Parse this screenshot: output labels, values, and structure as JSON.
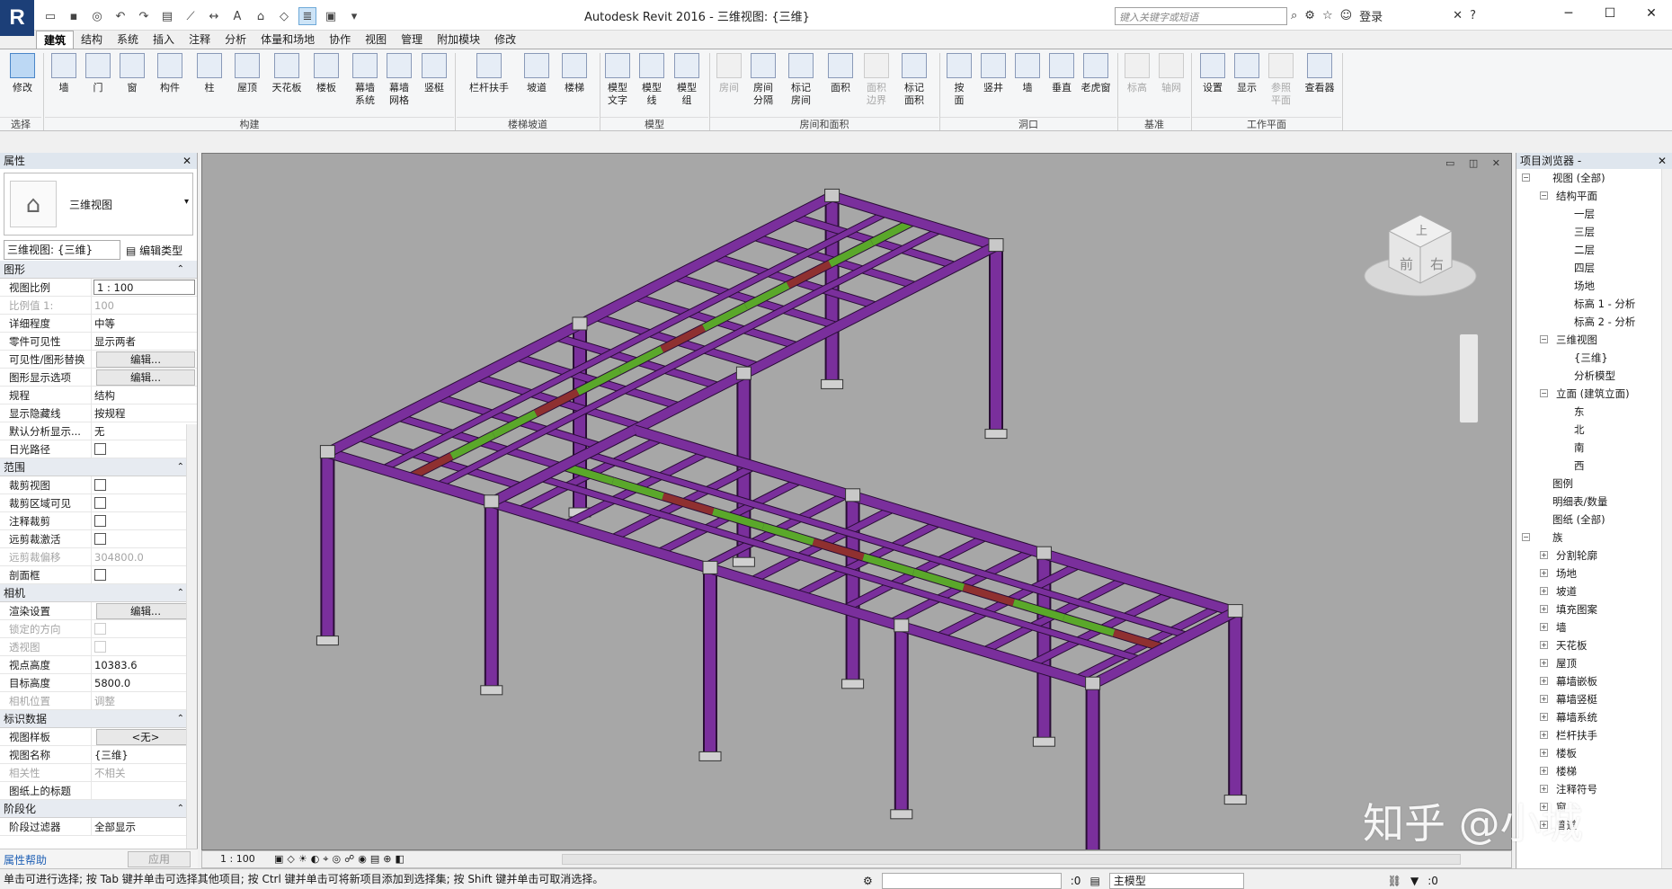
{
  "titlebar": {
    "app": "R",
    "title": "Autodesk Revit 2016 -    三维视图: {三维}",
    "search_placeholder": "键入关键字或短语",
    "login": "登录",
    "help": "?"
  },
  "ribbon_tabs": [
    "建筑",
    "结构",
    "系统",
    "插入",
    "注释",
    "分析",
    "体量和场地",
    "协作",
    "视图",
    "管理",
    "附加模块",
    "修改"
  ],
  "ribbon": {
    "select_label": "选择",
    "modify": "修改",
    "groups": [
      "构建",
      "楼梯坡道",
      "模型",
      "房间和面积",
      "洞口",
      "基准",
      "工作平面"
    ],
    "buttons": {
      "wall": "墙",
      "door": "门",
      "window": "窗",
      "component": "构件",
      "column": "柱",
      "roof": "屋顶",
      "ceiling": "天花板",
      "floor": "楼板",
      "curtain_system_1": "幕墙",
      "curtain_system_2": "系统",
      "curtain_grid_1": "幕墙",
      "curtain_grid_2": "网格",
      "mullion": "竖梃",
      "railing": "栏杆扶手",
      "ramp": "坡道",
      "stair": "楼梯",
      "model_text_1": "模型",
      "model_text_2": "文字",
      "model_line_1": "模型",
      "model_line_2": "线",
      "model_group_1": "模型",
      "model_group_2": "组",
      "room": "房间",
      "room_sep_1": "房间",
      "room_sep_2": "分隔",
      "tag_room_1": "标记",
      "tag_room_2": "房间",
      "area": "面积",
      "area_boundary_1": "面积",
      "area_boundary_2": "边界",
      "tag_area_1": "标记",
      "tag_area_2": "面积",
      "by_face_1": "按",
      "by_face_2": "面",
      "shaft": "竖井",
      "opening_wall": "墙",
      "vertical": "垂直",
      "dormer": "老虎窗",
      "level": "标高",
      "grid": "轴网",
      "set": "设置",
      "show": "显示",
      "ref_plane_1": "参照",
      "ref_plane_2": "平面",
      "viewer": "查看器"
    }
  },
  "properties": {
    "title": "属性",
    "type_name": "三维视图",
    "view_selector": "三维视图: {三维}",
    "edit_type": "编辑类型",
    "sections": [
      {
        "name": "图形",
        "rows": [
          {
            "k": "视图比例",
            "v": "1 : 100",
            "t": "input"
          },
          {
            "k": "比例值 1:",
            "v": "100",
            "t": "dis"
          },
          {
            "k": "详细程度",
            "v": "中等",
            "t": "text"
          },
          {
            "k": "零件可见性",
            "v": "显示两者",
            "t": "text"
          },
          {
            "k": "可见性/图形替换",
            "v": "编辑...",
            "t": "btn"
          },
          {
            "k": "图形显示选项",
            "v": "编辑...",
            "t": "btn"
          },
          {
            "k": "规程",
            "v": "结构",
            "t": "text"
          },
          {
            "k": "显示隐藏线",
            "v": "按规程",
            "t": "text"
          },
          {
            "k": "默认分析显示...",
            "v": "无",
            "t": "text"
          },
          {
            "k": "日光路径",
            "v": "",
            "t": "chk"
          }
        ]
      },
      {
        "name": "范围",
        "rows": [
          {
            "k": "裁剪视图",
            "v": "",
            "t": "chk"
          },
          {
            "k": "裁剪区域可见",
            "v": "",
            "t": "chk"
          },
          {
            "k": "注释裁剪",
            "v": "",
            "t": "chk"
          },
          {
            "k": "远剪裁激活",
            "v": "",
            "t": "chk"
          },
          {
            "k": "远剪裁偏移",
            "v": "304800.0",
            "t": "dis"
          },
          {
            "k": "剖面框",
            "v": "",
            "t": "chk"
          }
        ]
      },
      {
        "name": "相机",
        "rows": [
          {
            "k": "渲染设置",
            "v": "编辑...",
            "t": "btn"
          },
          {
            "k": "锁定的方向",
            "v": "",
            "t": "dischk"
          },
          {
            "k": "透视图",
            "v": "",
            "t": "dischk"
          },
          {
            "k": "视点高度",
            "v": "10383.6",
            "t": "text"
          },
          {
            "k": "目标高度",
            "v": "5800.0",
            "t": "text"
          },
          {
            "k": "相机位置",
            "v": "调整",
            "t": "dis"
          }
        ]
      },
      {
        "name": "标识数据",
        "rows": [
          {
            "k": "视图样板",
            "v": "<无>",
            "t": "btn"
          },
          {
            "k": "视图名称",
            "v": "{三维}",
            "t": "text"
          },
          {
            "k": "相关性",
            "v": "不相关",
            "t": "dis"
          },
          {
            "k": "图纸上的标题",
            "v": "",
            "t": "text"
          }
        ]
      },
      {
        "name": "阶段化",
        "rows": [
          {
            "k": "阶段过滤器",
            "v": "全部显示",
            "t": "text"
          }
        ]
      }
    ],
    "help": "属性帮助",
    "apply": "应用"
  },
  "viewport": {
    "scale": "1 : 100",
    "viewcube_top": "上",
    "viewcube_front": "前",
    "viewcube_right": "右"
  },
  "browser": {
    "title": "项目浏览器 -",
    "nodes": [
      {
        "label": "视图 (全部)",
        "lvl": 0,
        "tg": "−"
      },
      {
        "label": "结构平面",
        "lvl": 1,
        "tg": "−"
      },
      {
        "label": "一层",
        "lvl": 2
      },
      {
        "label": "三层",
        "lvl": 2
      },
      {
        "label": "二层",
        "lvl": 2
      },
      {
        "label": "四层",
        "lvl": 2
      },
      {
        "label": "场地",
        "lvl": 2
      },
      {
        "label": "标高 1 - 分析",
        "lvl": 2
      },
      {
        "label": "标高 2 - 分析",
        "lvl": 2
      },
      {
        "label": "三维视图",
        "lvl": 1,
        "tg": "−"
      },
      {
        "label": "{三维}",
        "lvl": 2
      },
      {
        "label": "分析模型",
        "lvl": 2
      },
      {
        "label": "立面 (建筑立面)",
        "lvl": 1,
        "tg": "−"
      },
      {
        "label": "东",
        "lvl": 2
      },
      {
        "label": "北",
        "lvl": 2
      },
      {
        "label": "南",
        "lvl": 2
      },
      {
        "label": "西",
        "lvl": 2
      },
      {
        "label": "图例",
        "lvl": 0
      },
      {
        "label": "明细表/数量",
        "lvl": 0
      },
      {
        "label": "图纸 (全部)",
        "lvl": 0
      },
      {
        "label": "族",
        "lvl": 0,
        "tg": "−"
      },
      {
        "label": "分割轮廓",
        "lvl": 1,
        "tg": "+"
      },
      {
        "label": "场地",
        "lvl": 1,
        "tg": "+"
      },
      {
        "label": "坡道",
        "lvl": 1,
        "tg": "+"
      },
      {
        "label": "填充图案",
        "lvl": 1,
        "tg": "+"
      },
      {
        "label": "墙",
        "lvl": 1,
        "tg": "+"
      },
      {
        "label": "天花板",
        "lvl": 1,
        "tg": "+"
      },
      {
        "label": "屋顶",
        "lvl": 1,
        "tg": "+"
      },
      {
        "label": "幕墙嵌板",
        "lvl": 1,
        "tg": "+"
      },
      {
        "label": "幕墙竖梃",
        "lvl": 1,
        "tg": "+"
      },
      {
        "label": "幕墙系统",
        "lvl": 1,
        "tg": "+"
      },
      {
        "label": "栏杆扶手",
        "lvl": 1,
        "tg": "+"
      },
      {
        "label": "楼板",
        "lvl": 1,
        "tg": "+"
      },
      {
        "label": "楼梯",
        "lvl": 1,
        "tg": "+"
      },
      {
        "label": "注释符号",
        "lvl": 1,
        "tg": "+"
      },
      {
        "label": "窗",
        "lvl": 1,
        "tg": "+"
      },
      {
        "label": "管道",
        "lvl": 1,
        "tg": "+"
      }
    ]
  },
  "statusbar": {
    "text": "单击可进行选择; 按 Tab 键并单击可选择其他项目; 按 Ctrl 键并单击可将新项目添加到选择集; 按 Shift 键并单击可取消选择。",
    "count1": ":0",
    "model": "主模型",
    "filter_count": ":0"
  },
  "watermark": "知乎 @小城",
  "colors": {
    "column": "#7a2f9c",
    "beam_green": "#5aa82a",
    "beam_red": "#8f3030",
    "viewport_bg": "#a7a7a7"
  }
}
